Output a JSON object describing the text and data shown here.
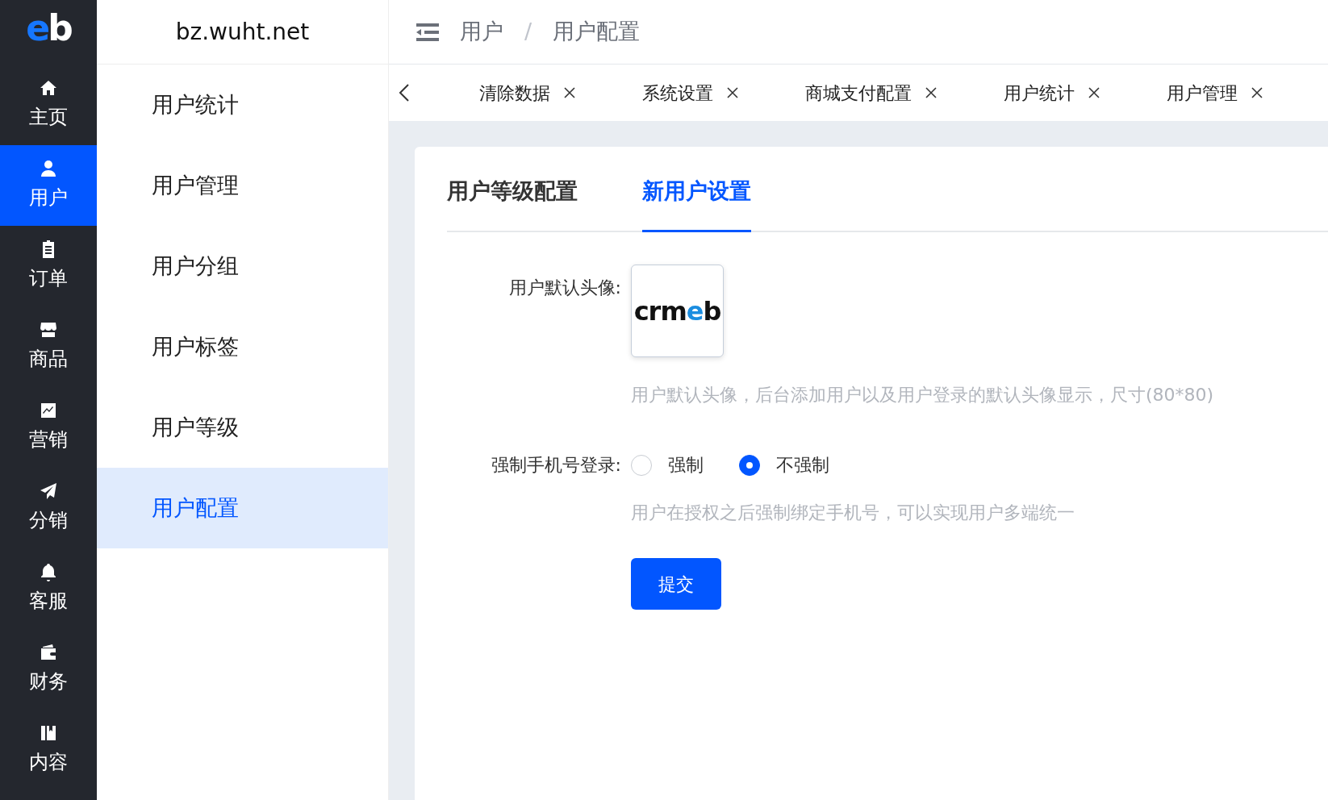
{
  "logo": [
    "e",
    "b"
  ],
  "rail": [
    {
      "label": "主页",
      "selected": false
    },
    {
      "label": "用户",
      "selected": true
    },
    {
      "label": "订单",
      "selected": false
    },
    {
      "label": "商品",
      "selected": false
    },
    {
      "label": "营销",
      "selected": false
    },
    {
      "label": "分销",
      "selected": false
    },
    {
      "label": "客服",
      "selected": false
    },
    {
      "label": "财务",
      "selected": false
    },
    {
      "label": "内容",
      "selected": false
    }
  ],
  "site_title": "bz.wuht.net",
  "submenu": [
    {
      "label": "用户统计",
      "selected": false
    },
    {
      "label": "用户管理",
      "selected": false
    },
    {
      "label": "用户分组",
      "selected": false
    },
    {
      "label": "用户标签",
      "selected": false
    },
    {
      "label": "用户等级",
      "selected": false
    },
    {
      "label": "用户配置",
      "selected": true
    }
  ],
  "breadcrumb": [
    "用户",
    "用户配置"
  ],
  "breadcrumb_separator": "/",
  "open_tabs": [
    {
      "label": "清除数据"
    },
    {
      "label": "系统设置"
    },
    {
      "label": "商城支付配置"
    },
    {
      "label": "用户统计"
    },
    {
      "label": "用户管理"
    }
  ],
  "card_tabs": [
    {
      "label": "用户等级配置",
      "selected": false
    },
    {
      "label": "新用户设置",
      "selected": true
    }
  ],
  "form": {
    "avatar_label": "用户默认头像:",
    "avatar_logo": [
      "crm",
      "e",
      "b"
    ],
    "avatar_help": "用户默认头像，后台添加用户以及用户登录的默认头像显示，尺寸(80*80)",
    "phone_label": "强制手机号登录:",
    "options": [
      {
        "label": "强制",
        "selected": false
      },
      {
        "label": "不强制",
        "selected": true
      }
    ],
    "phone_help": "用户在授权之后强制绑定手机号，可以实现用户多端统一",
    "submit": "提交"
  }
}
